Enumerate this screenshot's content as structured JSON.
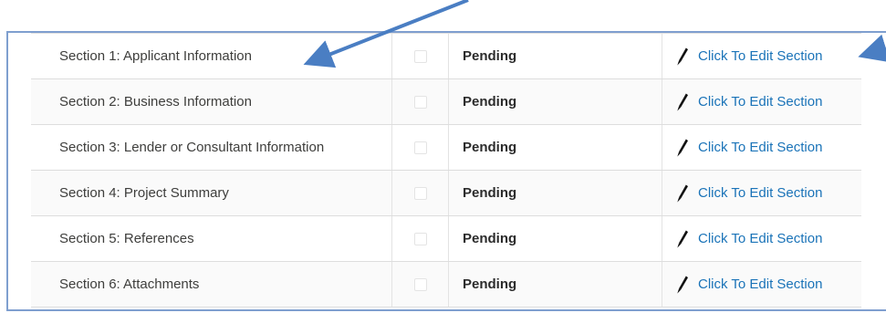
{
  "sections": [
    {
      "label": "Section 1: Applicant Information",
      "status": "Pending",
      "action": "Click To Edit Section",
      "checked": false
    },
    {
      "label": "Section 2: Business Information",
      "status": "Pending",
      "action": "Click To Edit Section",
      "checked": false
    },
    {
      "label": "Section 3: Lender or Consultant Information",
      "status": "Pending",
      "action": "Click To Edit Section",
      "checked": false
    },
    {
      "label": "Section 4: Project Summary",
      "status": "Pending",
      "action": "Click To Edit Section",
      "checked": false
    },
    {
      "label": "Section 5: References",
      "status": "Pending",
      "action": "Click To Edit Section",
      "checked": false
    },
    {
      "label": "Section 6: Attachments",
      "status": "Pending",
      "action": "Click To Edit Section",
      "checked": false
    }
  ],
  "icons": {
    "edit": "pencil-icon",
    "annotation": "arrow-annotation"
  },
  "colors": {
    "link": "#1a73b8",
    "annotation_arrow": "#4a7ec3",
    "frame_border": "#7f9fcf"
  }
}
